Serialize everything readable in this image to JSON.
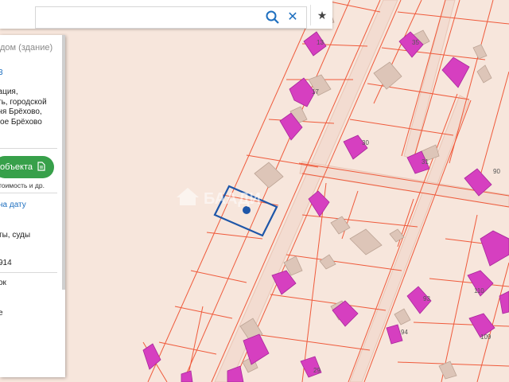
{
  "search": {
    "value": "",
    "placeholder": ""
  },
  "toolbar": {
    "search_icon": "search-icon",
    "clear_icon": "close-icon",
    "clear_glyph": "✕",
    "favorite_icon": "star-icon",
    "favorite_glyph": "★"
  },
  "panel": {
    "header": "дом (здание)",
    "number_link": "3",
    "address": "рация,\nсть, городской\nвня Брёхово,\nшое Брёхово",
    "button_label": "объекта",
    "note": "тоимость и др.",
    "date_link": "на дату",
    "text_1": "ты, суды",
    "text_2": "914",
    "text_3": "ок",
    "text_4": "е"
  },
  "map": {
    "watermark": "БААДИ",
    "colors": {
      "background": "#f7e6dc",
      "parcel_line": "#ef5a3b",
      "building": "#d63fc0",
      "marker": "#1e56a8"
    },
    "labels": [
      "13",
      "17",
      "35",
      "30",
      "31",
      "90",
      "93",
      "110",
      "94",
      "109",
      "29"
    ]
  }
}
